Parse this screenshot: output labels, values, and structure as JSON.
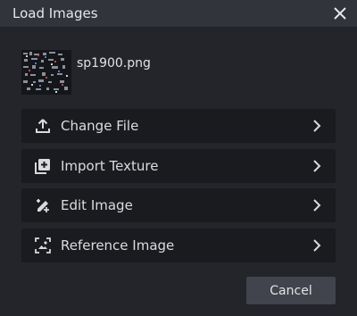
{
  "window": {
    "title": "Load Images"
  },
  "file": {
    "name": "sp1900.png"
  },
  "menu": [
    {
      "label": "Change File",
      "icon": "upload-icon"
    },
    {
      "label": "Import Texture",
      "icon": "add-texture-icon"
    },
    {
      "label": "Edit Image",
      "icon": "edit-image-icon"
    },
    {
      "label": "Reference Image",
      "icon": "reference-image-icon"
    }
  ],
  "actions": {
    "cancel_label": "Cancel"
  },
  "colors": {
    "background": "#23252b",
    "titlebar": "#31343b",
    "item": "#191b1f",
    "button": "#41444c"
  }
}
